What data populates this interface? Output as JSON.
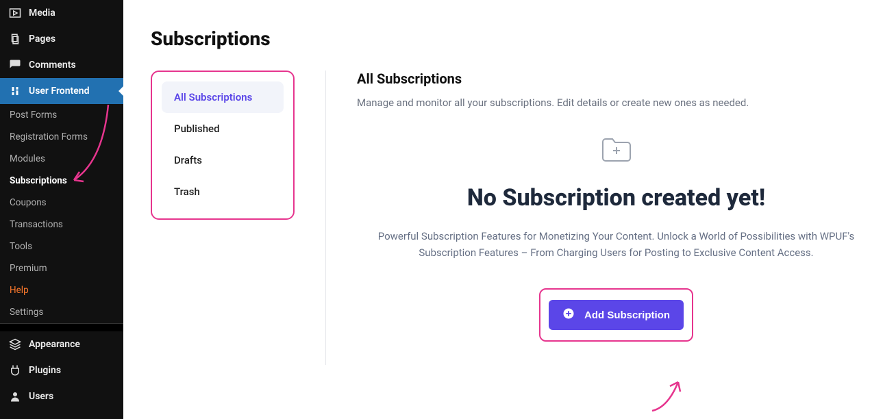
{
  "sidebar": {
    "media": "Media",
    "pages": "Pages",
    "comments": "Comments",
    "userFrontend": "User Frontend",
    "sub": {
      "postForms": "Post Forms",
      "registrationForms": "Registration Forms",
      "modules": "Modules",
      "subscriptions": "Subscriptions",
      "coupons": "Coupons",
      "transactions": "Transactions",
      "tools": "Tools",
      "premium": "Premium",
      "help": "Help",
      "settings": "Settings"
    },
    "appearance": "Appearance",
    "plugins": "Plugins",
    "users": "Users"
  },
  "page": {
    "title": "Subscriptions"
  },
  "tabs": {
    "all": "All Subscriptions",
    "published": "Published",
    "drafts": "Drafts",
    "trash": "Trash"
  },
  "detail": {
    "heading": "All Subscriptions",
    "desc": "Manage and monitor all your subscriptions. Edit details or create new ones as needed.",
    "emptyTitle": "No Subscription created yet!",
    "emptyText": "Powerful Subscription Features for Monetizing Your Content. Unlock a World of Possibilities with WPUF's Subscription Features – From Charging Users for Posting to Exclusive Content Access.",
    "addBtn": "Add Subscription"
  }
}
